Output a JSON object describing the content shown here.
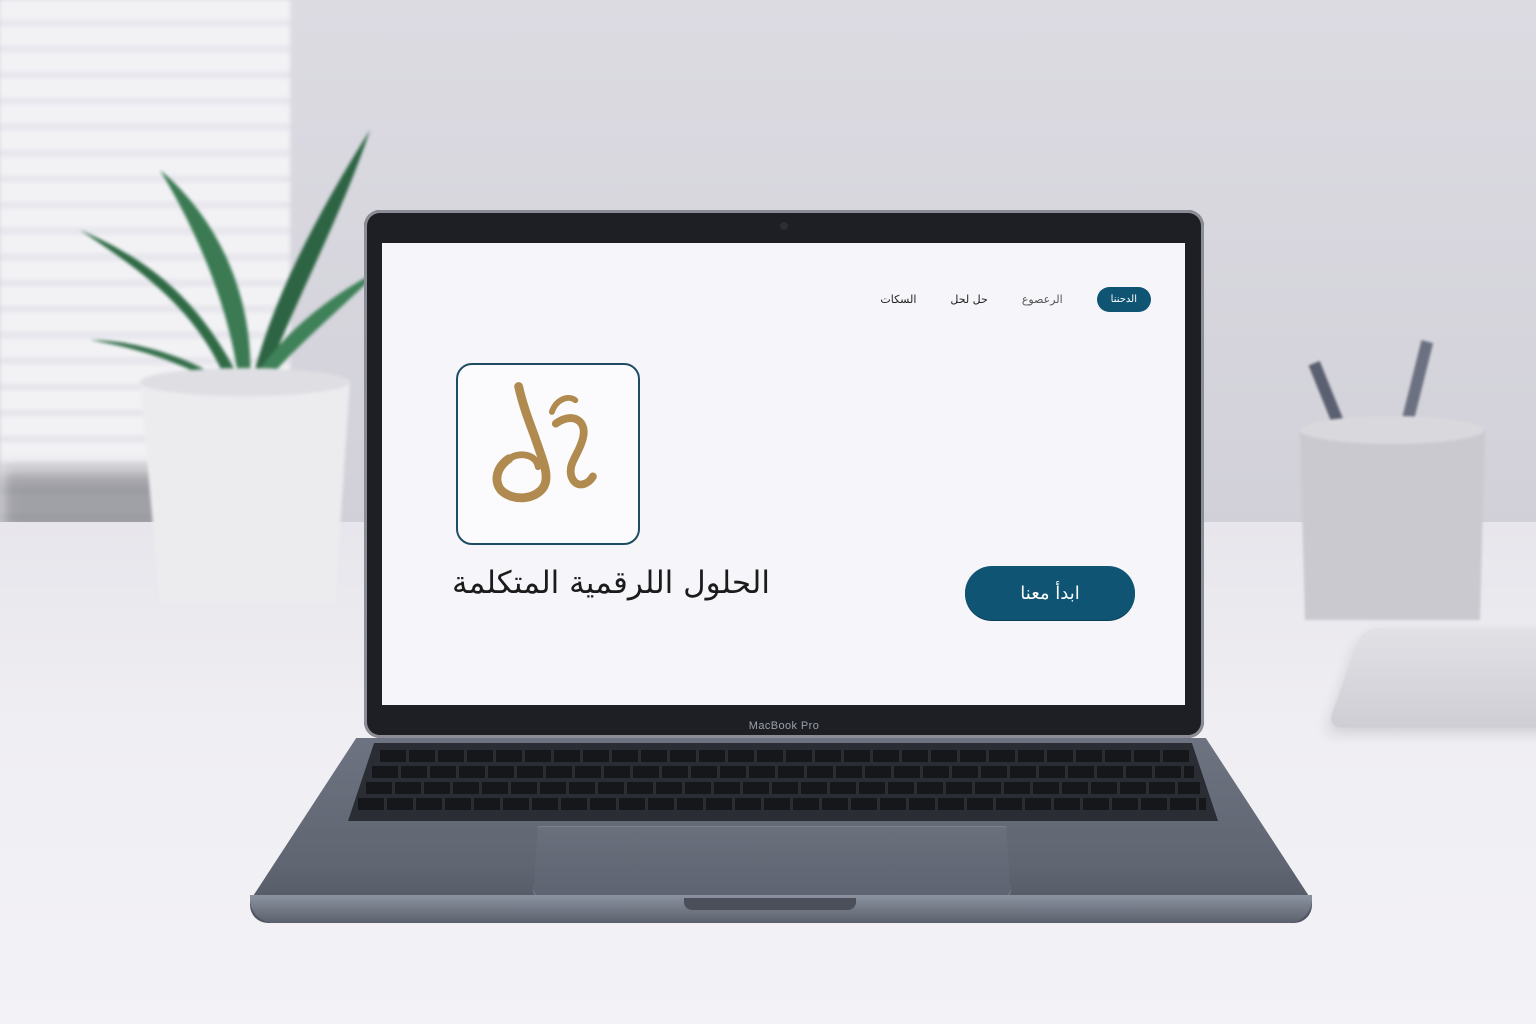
{
  "device": {
    "label": "MacBook Pro"
  },
  "nav": {
    "items": [
      {
        "label": "السكات",
        "style": "link"
      },
      {
        "label": "حل لحل",
        "style": "link"
      },
      {
        "label": "الرعصوع",
        "style": "muted"
      },
      {
        "label": "الدحننا",
        "style": "pill"
      }
    ]
  },
  "hero": {
    "logo_icon": "arabic-calligraphy-logo",
    "title": "الحلول اللرقمية المتكلمة",
    "cta_label": "ابدأ معنا"
  },
  "colors": {
    "accent": "#0f5473",
    "logo_gold": "#b08a4f",
    "logo_border": "#1e4d63",
    "screen_bg": "#f6f6fa"
  }
}
